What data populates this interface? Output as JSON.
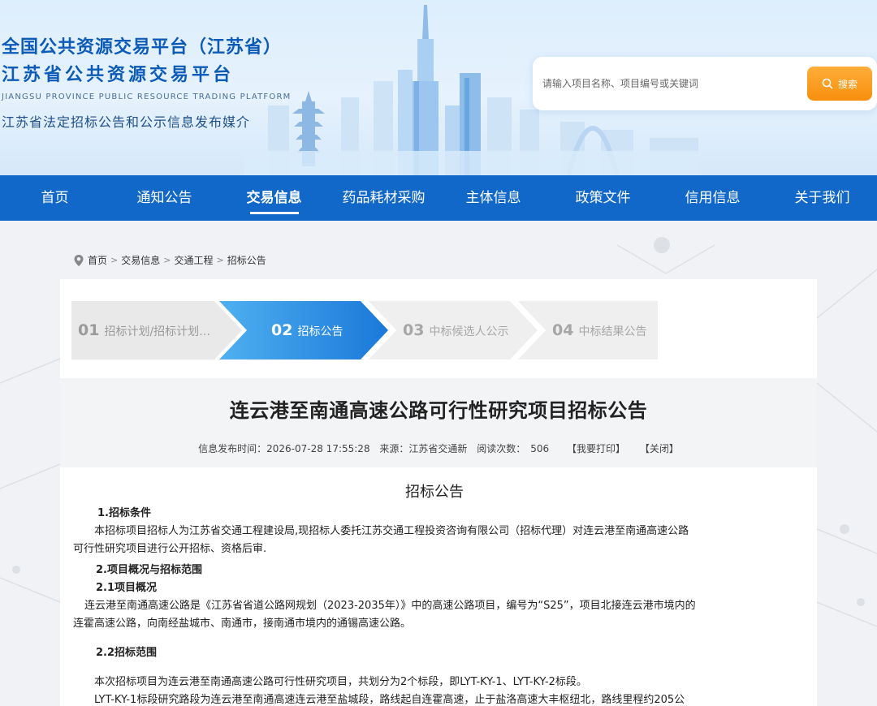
{
  "header": {
    "title_line1": "全国公共资源交易平台（江苏省）",
    "title_line2": "江苏省公共资源交易平台",
    "title_en": "JIANGSU PROVINCE PUBLIC RESOURCE TRADING PLATFORM",
    "subtitle": "江苏省法定招标公告和公示信息发布媒介",
    "search": {
      "placeholder": "请输入项目名称、项目编号或关键词",
      "button_label": "搜索",
      "button_icon": "search-icon",
      "button_color": "#f99b1c"
    }
  },
  "nav": {
    "items": [
      "首页",
      "通知公告",
      "交易信息",
      "药品耗材采购",
      "主体信息",
      "政策文件",
      "信用信息",
      "关于我们"
    ],
    "active": "交易信息",
    "color": "#1168c9"
  },
  "breadcrumb": {
    "icon": "location-pin-icon",
    "items": [
      "首页",
      "交易信息",
      "交通工程",
      "招标公告"
    ],
    "separator": ">"
  },
  "steps": [
    {
      "num": "01",
      "label": "招标计划/招标计划…",
      "state": "done"
    },
    {
      "num": "02",
      "label": "招标公告",
      "state": "active"
    },
    {
      "num": "03",
      "label": "中标候选人公示",
      "state": "todo"
    },
    {
      "num": "04",
      "label": "中标结果公告",
      "state": "todo"
    }
  ],
  "article": {
    "title": "连云港至南通高速公路可行性研究项目招标公告",
    "meta": {
      "publish_label": "信息发布时间：",
      "publish_time": "2026-07-28 17:55:28",
      "source_label": "来源：",
      "source": "江苏省交通新",
      "views_label": "阅读次数：",
      "views": "506",
      "print_label": "【我要打印】",
      "close_label": "【关闭】"
    },
    "subtitle": "招标公告",
    "s1_heading": "1.招标条件",
    "s1_text": "本招标项目招标人为江苏省交通工程建设局,现招标人委托江苏交通工程投资咨询有限公司（招标代理）对连云港至南通高速公路",
    "s1_text2": "可行性研究项目进行公开招标、资格后审.",
    "s2_heading": "2.项目概况与招标范围",
    "s21_heading": "2.1项目概况",
    "s21_text": "连云港至南通高速公路是《江苏省省道公路网规划（2023-2035年）》中的高速公路项目，编号为“S25”，项目北接连云港市境内的",
    "s21_text2": "连霍高速公路，向南经盐城市、南通市，接南通市境内的通锡高速公路。",
    "s22_heading": "2.2招标范围",
    "s22_text": "本次招标项目为连云港至南通高速公路可行性研究项目，共划分为2个标段，即LYT-KY-1、LYT-KY-2标段。",
    "s22_text2": "LYT-KY-1标段研究路段为连云港至南通高速连云港至盐城段，路线起自连霍高速，止于盐洛高速大丰枢纽北，路线里程约205公"
  }
}
